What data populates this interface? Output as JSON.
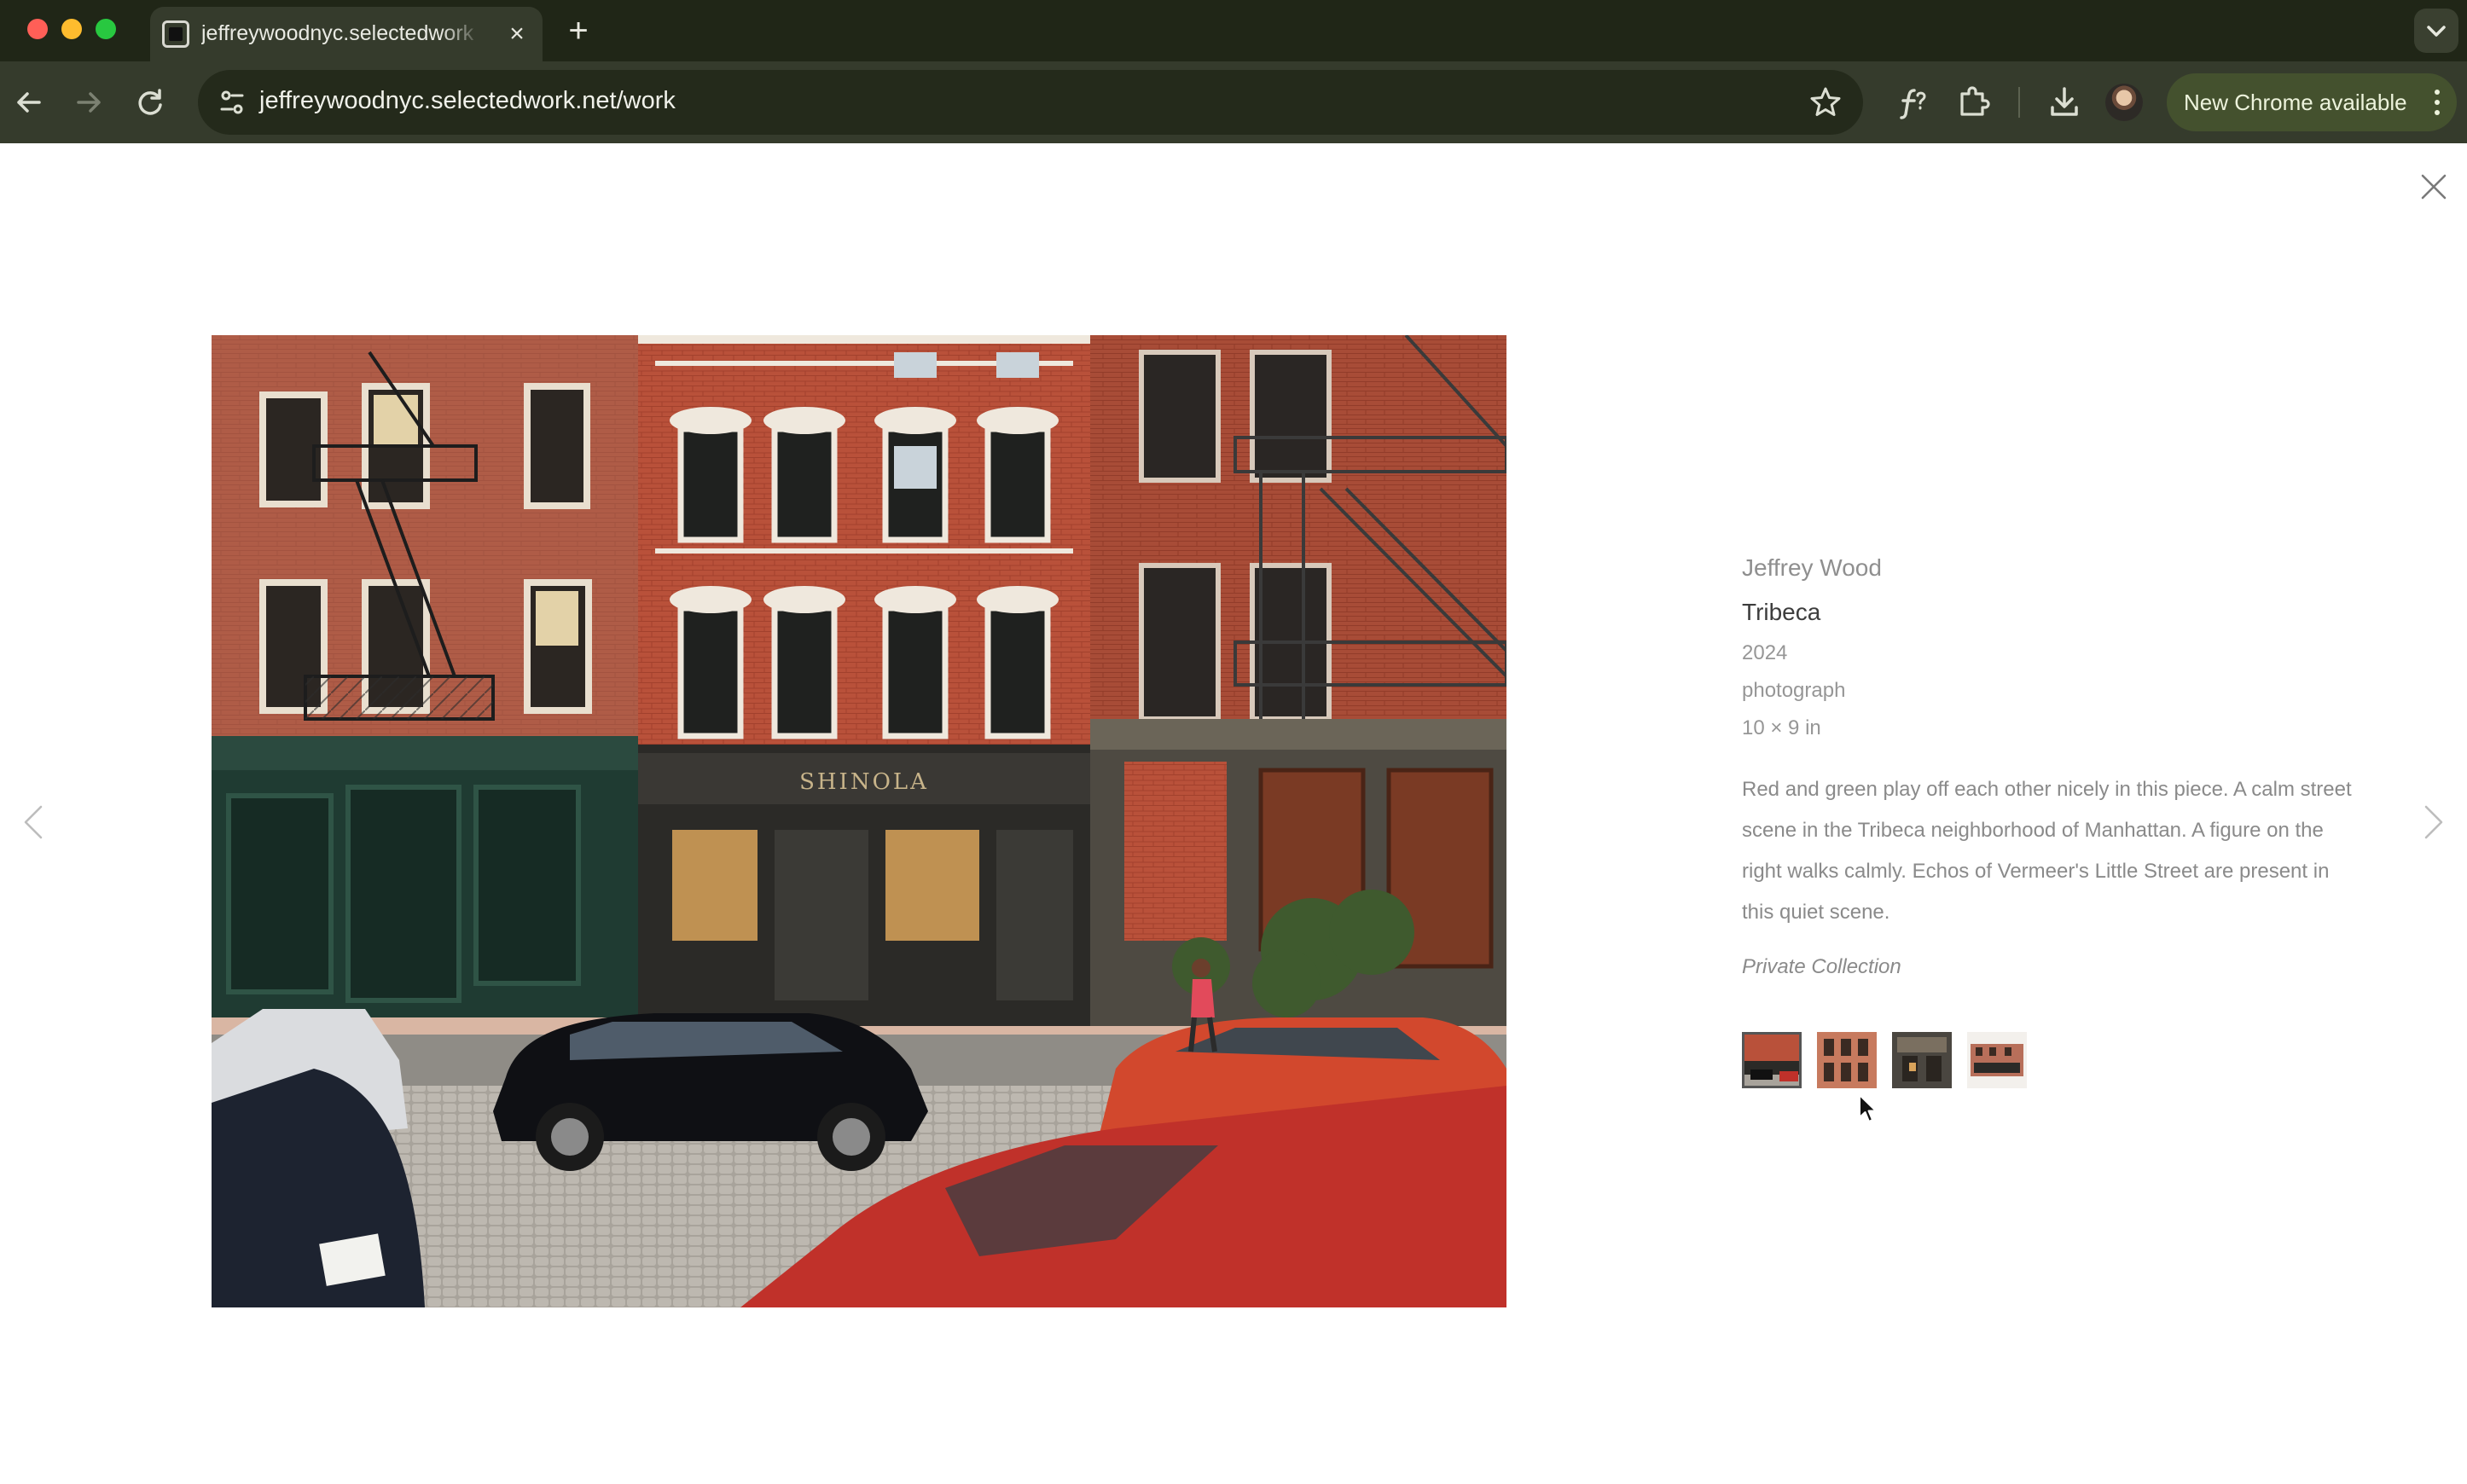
{
  "browser": {
    "tab_title": "jeffreywoodnyc.selectedwork",
    "url": "jeffreywoodnyc.selectedwork.net/work",
    "update_label": "New Chrome available",
    "icons": [
      "back-arrow-icon",
      "forward-arrow-icon",
      "reload-icon",
      "site-info-icon",
      "star-icon",
      "font-icon",
      "extensions-icon",
      "download-icon",
      "profile-avatar",
      "more-vert-icon"
    ]
  },
  "artwork": {
    "artist": "Jeffrey Wood",
    "title": "Tribeca",
    "year": "2024",
    "medium": "photograph",
    "dimensions": "10 × 9 in",
    "description": "Red and green play off each other nicely in this piece. A calm street scene in the Tribeca neighborhood of Manhattan. A figure on the right walks calmly. Echos of Vermeer's Little Street are present in this quiet scene.",
    "collection": "Private Collection",
    "image_label": "SHINOLA",
    "thumbnail_count": 4,
    "active_thumbnail": 1
  },
  "colors": {
    "tabbar_bg": "#202617",
    "toolbar_bg": "#353b2c",
    "update_pill": "#44512e",
    "page_bg": "#ffffff"
  }
}
